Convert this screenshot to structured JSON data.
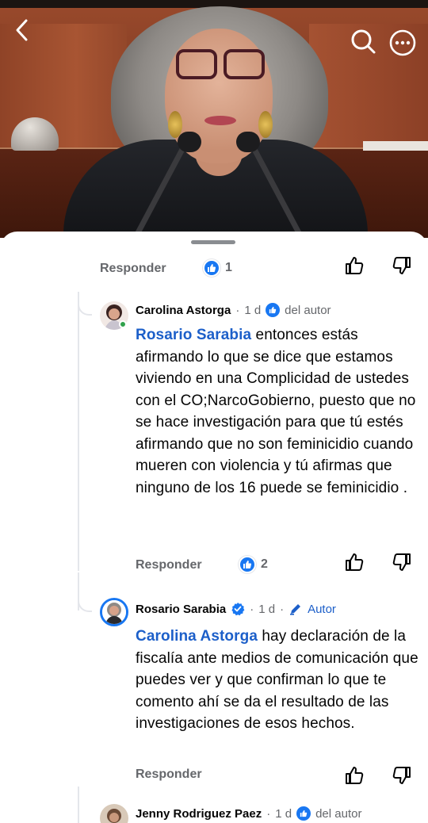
{
  "header": {
    "back_icon": "chevron-left-icon",
    "search_icon": "search-icon",
    "more_icon": "more-horizontal-icon"
  },
  "top_actions": {
    "reply_label": "Responder",
    "reaction_count": "1"
  },
  "comments": [
    {
      "author": "Carolina Astorga",
      "time": "1 d",
      "badge": "del autor",
      "mention": "Rosario Sarabia",
      "text": " entonces estás afirmando lo que se dice que estamos viviendo en una Complicidad de ustedes con el CO;NarcoGobierno, puesto que no se hace investigación para que tú estés afirmando que no son feminicidio cuando mueren con violencia y tú afirmas que ninguno de los 16 puede se feminicidio .",
      "reply_label": "Responder",
      "reaction_count": "2"
    },
    {
      "author": "Rosario Sarabia",
      "time": "1 d",
      "badge": "Autor",
      "mention": "Carolina Astorga",
      "text": " hay declaración de la fiscalía ante medios de comunicación que puedes ver y que confirman lo que te comento ahí se da el resultado de las investigaciones de esos hechos.",
      "reply_label": "Responder"
    },
    {
      "author": "Jenny Rodriguez Paez",
      "time": "1 d",
      "badge": "del autor"
    }
  ],
  "colors": {
    "mention": "#1c5fc9",
    "like_blue": "#1877f2",
    "muted_text": "#65676b"
  }
}
